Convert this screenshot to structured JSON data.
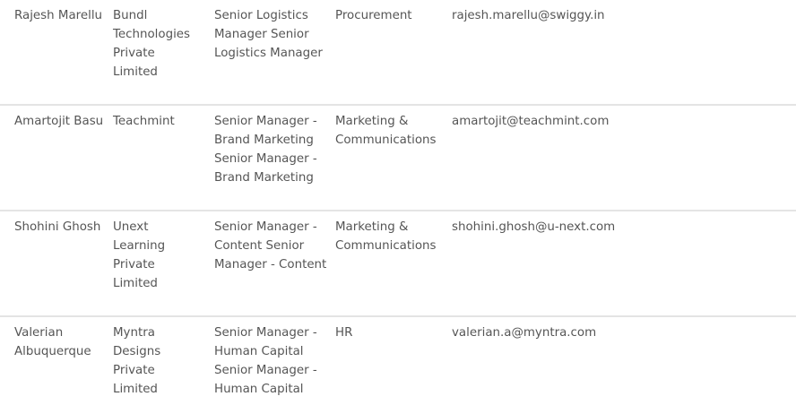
{
  "contacts": [
    {
      "name": "Rajesh Marellu",
      "company": "Bundl Technologies Private Limited",
      "title": "Senior Logistics Manager Senior Logistics Manager",
      "department": "Procurement",
      "email": "rajesh.marellu@swiggy.in"
    },
    {
      "name": "Amartojit Basu",
      "company": "Teachmint",
      "title": "Senior Manager - Brand Marketing Senior Manager - Brand Marketing",
      "department": "Marketing & Communications",
      "email": "amartojit@teachmint.com"
    },
    {
      "name": "Shohini Ghosh",
      "company": "Unext Learning Private Limited",
      "title": "Senior Manager - Content Senior Manager - Content",
      "department": "Marketing & Communications",
      "email": "shohini.ghosh@u-next.com"
    },
    {
      "name": "Valerian Albuquerque",
      "company": "Myntra Designs Private Limited",
      "title": "Senior Manager - Human Capital Senior Manager - Human Capital",
      "department": "HR",
      "email": "valerian.a@myntra.com"
    }
  ]
}
